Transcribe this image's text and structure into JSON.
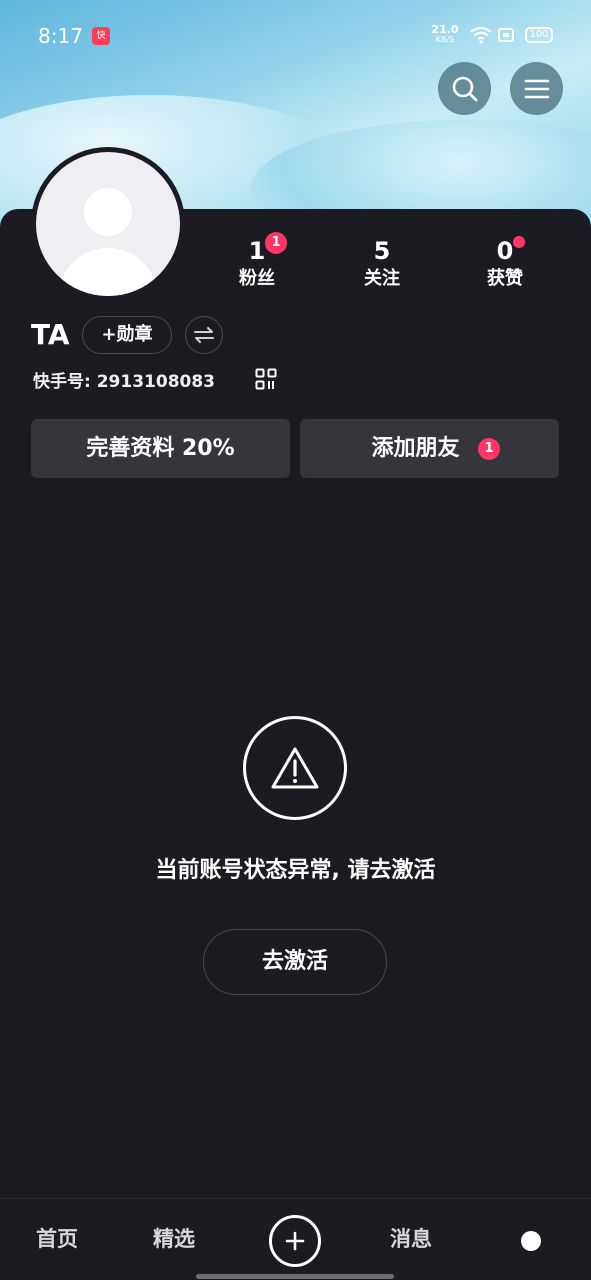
{
  "status_bar": {
    "time": "8:17",
    "app_icon_label": "快",
    "net_speed": "21.0",
    "net_unit": "KB/S",
    "battery": "100"
  },
  "profile": {
    "username": "TA",
    "medal_label": "+勋章",
    "uid": "快手号: 2913108083",
    "stats": {
      "fans": {
        "value": "1",
        "label": "粉丝",
        "badge": "1"
      },
      "following": {
        "value": "5",
        "label": "关注"
      },
      "likes": {
        "value": "0",
        "label": "获赞"
      }
    },
    "complete_profile_label": "完善资料 20%",
    "add_friends_label": "添加朋友",
    "add_friends_badge": "1"
  },
  "notice": {
    "message": "当前账号状态异常, 请去激活",
    "activate_label": "去激活"
  },
  "bottom_nav": {
    "home": "首页",
    "featured": "精选",
    "messages": "消息"
  },
  "colors": {
    "accent_badge": "#fe3666",
    "background": "#1c1b21",
    "button_bg": "#35353b"
  }
}
